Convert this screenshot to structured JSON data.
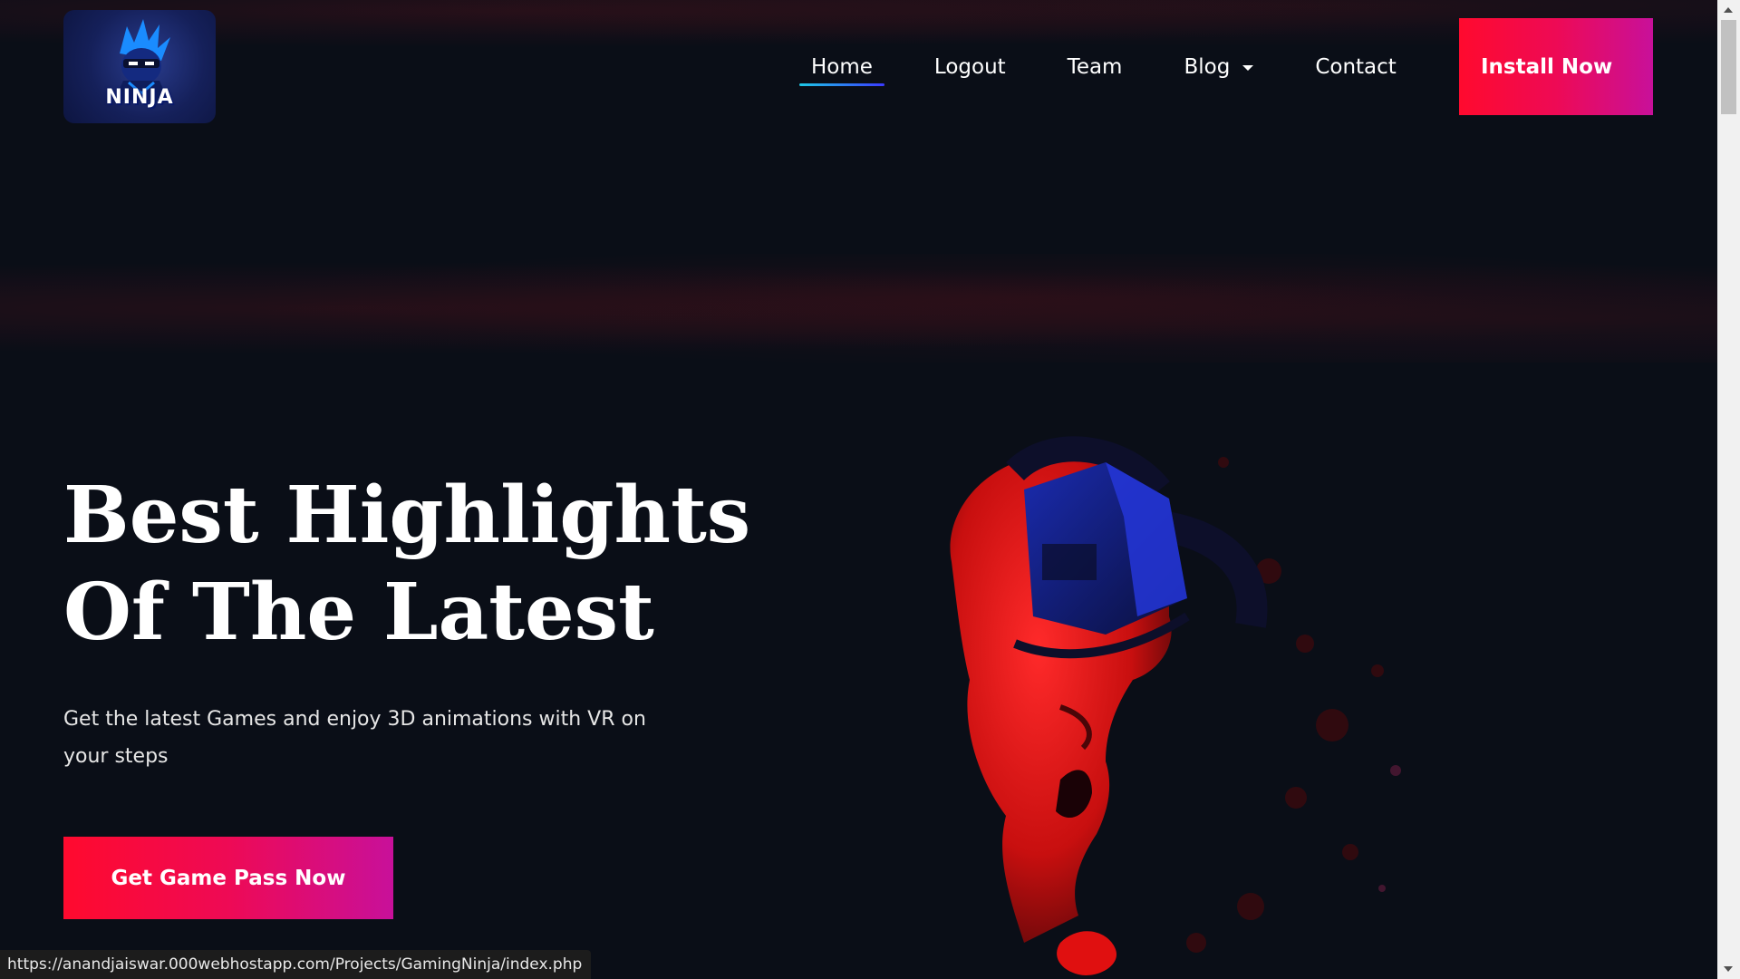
{
  "header": {
    "logo_text": "NINJA",
    "nav": [
      {
        "label": "Home",
        "active": true
      },
      {
        "label": "Logout"
      },
      {
        "label": "Team"
      },
      {
        "label": "Blog",
        "has_dropdown": true
      },
      {
        "label": "Contact"
      }
    ],
    "install_label": "Install Now"
  },
  "hero": {
    "title_line1": "Best Highlights",
    "title_line2": "Of The Latest",
    "subtitle": "Get the latest Games and enjoy 3D animations with VR on your steps",
    "cta_label": "Get Game Pass Now"
  },
  "status_bar": {
    "url": "https://anandjaiswar.000webhostapp.com/Projects/GamingNinja/index.php"
  },
  "colors": {
    "background": "#0a0e17",
    "button_gradient_start": "#ff0a2e",
    "button_gradient_end": "#c8109a",
    "nav_underline": "#1ec8e6"
  },
  "icons": {
    "logo": "ninja-mascot-icon",
    "blog_caret": "caret-down-icon",
    "hero": "vr-headset-person-image"
  }
}
